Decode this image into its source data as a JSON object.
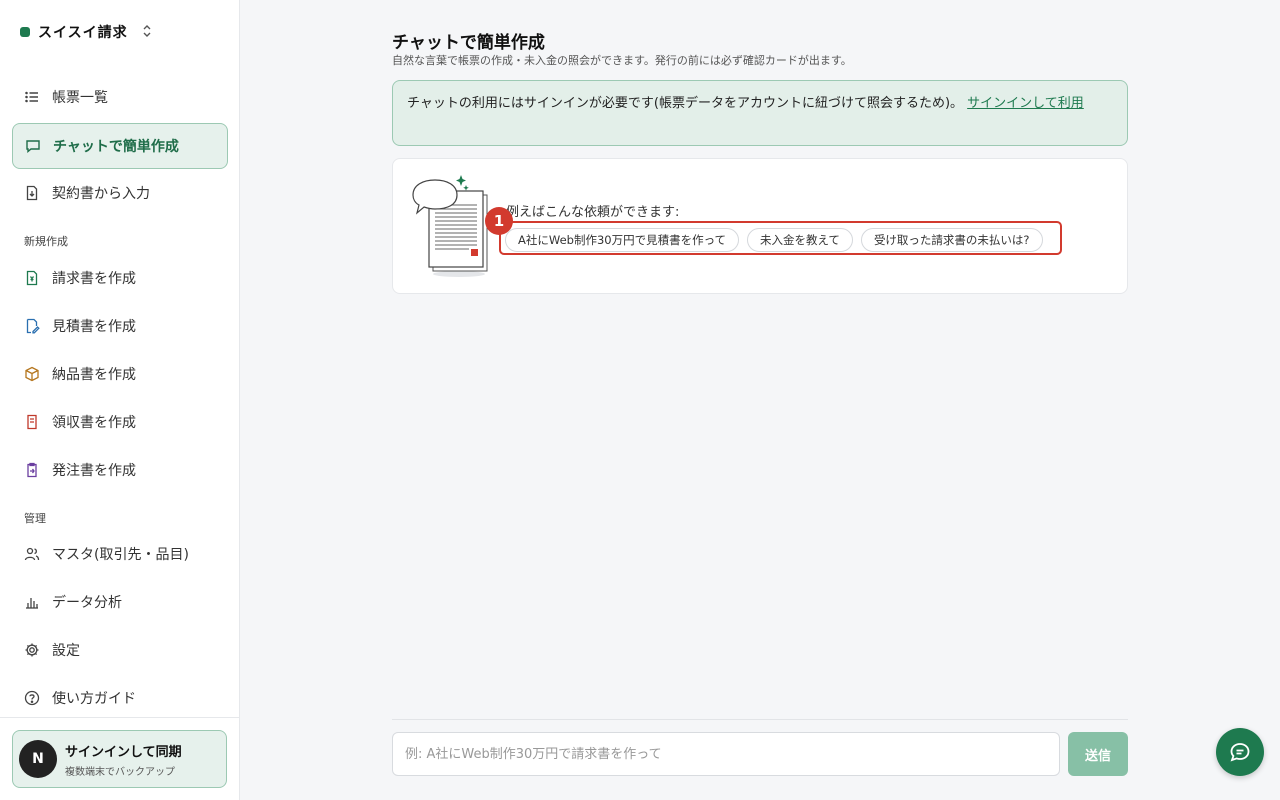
{
  "brand": {
    "name": "スイスイ請求",
    "chevron": "⌃⌄"
  },
  "sidebar": {
    "items": [
      {
        "label": "帳票一覧",
        "icon": "list-icon"
      },
      {
        "label": "チャットで簡単作成",
        "icon": "chat-icon",
        "active": true
      },
      {
        "label": "契約書から入力",
        "icon": "file-import-icon"
      }
    ],
    "section_new": "新規作成",
    "new_items": [
      {
        "label": "請求書を作成",
        "icon": "invoice-icon"
      },
      {
        "label": "見積書を作成",
        "icon": "quote-edit-icon"
      },
      {
        "label": "納品書を作成",
        "icon": "box-icon"
      },
      {
        "label": "領収書を作成",
        "icon": "receipt-icon"
      },
      {
        "label": "発注書を作成",
        "icon": "clipboard-icon"
      }
    ],
    "section_manage": "管理",
    "manage_items": [
      {
        "label": "マスタ(取引先・品目)",
        "icon": "users-icon"
      },
      {
        "label": "データ分析",
        "icon": "bar-chart-icon"
      },
      {
        "label": "設定",
        "icon": "gear-icon"
      },
      {
        "label": "使い方ガイド",
        "icon": "help-icon"
      }
    ],
    "signin": {
      "avatar": "N",
      "title": "サインインして同期",
      "subtitle": "複数端末でバックアップ"
    }
  },
  "main": {
    "title": "チャットで簡単作成",
    "subtitle": "自然な言葉で帳票の作成・未入金の照会ができます。発行の前には必ず確認カードが出ます。",
    "notice": {
      "text": "チャットの利用にはサインインが必要です(帳票データをアカウントに紐づけて照会するため)。",
      "link": "サインインして利用"
    },
    "examples": {
      "label": "例えばこんな依頼ができます:",
      "badge": "1",
      "chips": [
        "A社にWeb制作30万円で見積書を作って",
        "未入金を教えて",
        "受け取った請求書の未払いは?"
      ]
    },
    "input": {
      "placeholder": "例: A社にWeb制作30万円で請求書を作って",
      "value": ""
    },
    "send_label": "送信"
  },
  "colors": {
    "accent": "#1e7a4f",
    "highlight": "#d23a2e",
    "active_bg": "#e6f1ec"
  }
}
